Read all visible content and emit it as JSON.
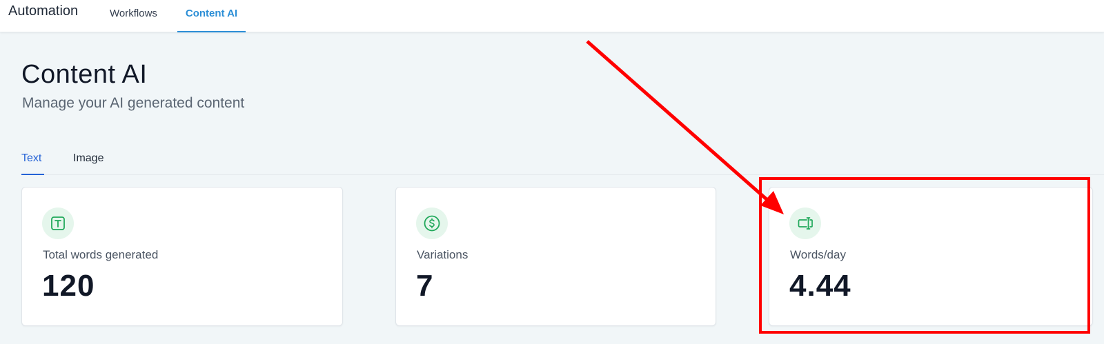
{
  "header": {
    "app_title": "Automation",
    "nav": [
      {
        "label": "Workflows"
      },
      {
        "label": "Content AI",
        "active": true
      }
    ]
  },
  "page": {
    "title": "Content AI",
    "subtitle": "Manage your AI generated content"
  },
  "tabs": [
    {
      "label": "Text",
      "active": true
    },
    {
      "label": "Image"
    }
  ],
  "stats": [
    {
      "icon": "text-t-icon",
      "label": "Total words generated",
      "value": "120"
    },
    {
      "icon": "dollar-icon",
      "label": "Variations",
      "value": "7"
    },
    {
      "icon": "text-cursor-icon",
      "label": "Words/day",
      "value": "4.44"
    }
  ],
  "colors": {
    "accent": "#2b8ed6",
    "tab_active": "#2462d6",
    "icon_green": "#20a85a",
    "annotation": "#ff0000"
  }
}
